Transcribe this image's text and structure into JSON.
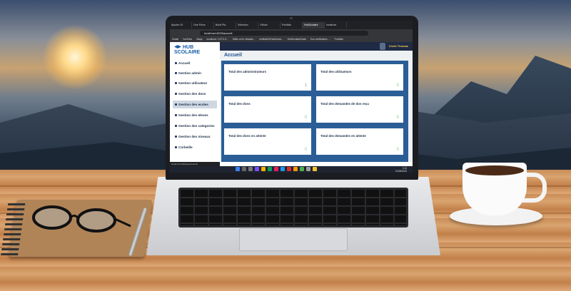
{
  "browser": {
    "tabs": [
      "Ajouter Gr",
      "One Piece",
      "Build Pla",
      "Sélection",
      "Github",
      "Portfolio",
      "HubScolaire",
      "localhost"
    ],
    "active_tab_index": 6,
    "url": "localhost:4200/accueil",
    "bookmarks": [
      "Gmail",
      "YouTube",
      "Maps",
      "localhost / 127.0.0...",
      "Skills on le virtualis...",
      "melliski23/HubScola...",
      "HubScolaireDash",
      "Ecc certification ...",
      "Portfolio"
    ]
  },
  "app": {
    "logo_text": "HUB SCOLAIRE",
    "user_name": "Cheik Thomas",
    "page_title": "Accueil",
    "sidebar": {
      "items": [
        {
          "label": "Accueil",
          "active": false
        },
        {
          "label": "Gestion admin",
          "active": false
        },
        {
          "label": "Gestion utilisateur",
          "active": false
        },
        {
          "label": "Gestion des dons",
          "active": false
        },
        {
          "label": "Gestion des ecoles",
          "active": true
        },
        {
          "label": "Gestion des eleves",
          "active": false
        },
        {
          "label": "Gestion des categories",
          "active": false
        },
        {
          "label": "Gestion des niveaux",
          "active": false
        },
        {
          "label": "Corbeille",
          "active": false
        }
      ]
    },
    "cards": [
      {
        "label": "Total des administrateurs",
        "value": "1"
      },
      {
        "label": "Total des utilisateurs",
        "value": "0"
      },
      {
        "label": "Total des dons",
        "value": "0"
      },
      {
        "label": "Total des demandes de don reçu",
        "value": "0"
      },
      {
        "label": "Total des dons en attente",
        "value": "0"
      },
      {
        "label": "Total des demandes en attente",
        "value": "0"
      }
    ]
  },
  "status": {
    "hover_url": "localhost:4200/gestionecole"
  },
  "taskbar": {
    "time": "2:16",
    "date": "01/08/2023"
  }
}
